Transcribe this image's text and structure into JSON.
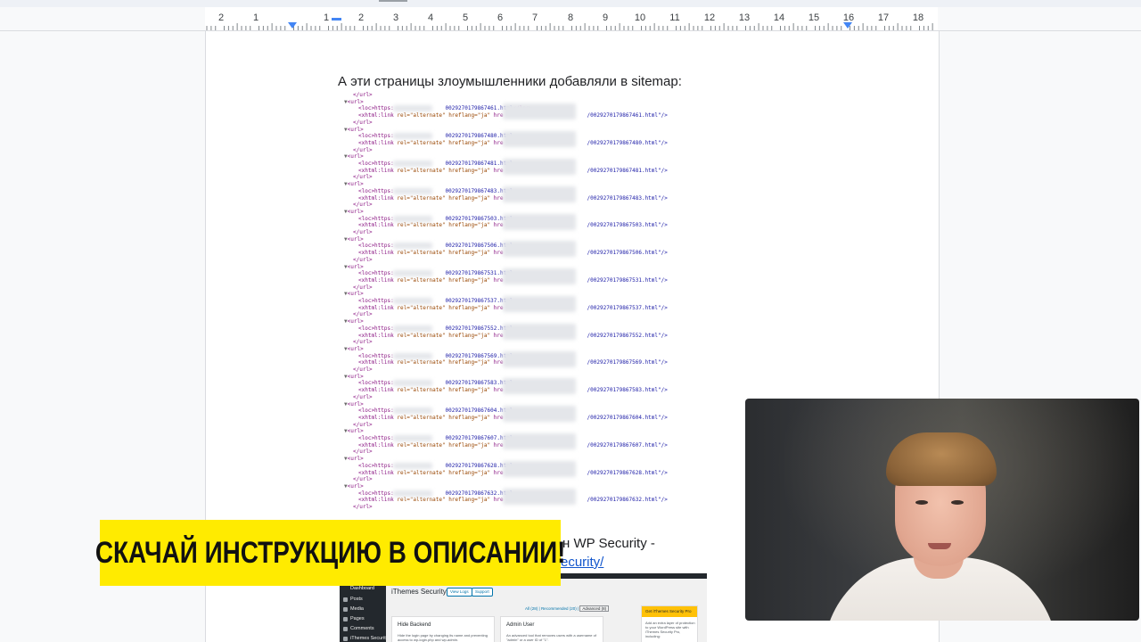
{
  "ruler": {
    "numbers": [
      "2",
      "1",
      "1",
      "2",
      "3",
      "4",
      "5",
      "6",
      "7",
      "8",
      "9",
      "10",
      "11",
      "12",
      "13",
      "14",
      "15",
      "16",
      "17",
      "18"
    ]
  },
  "document": {
    "heading": "А эти страницы злоумышленники добавляли в sitemap:",
    "sitemap_ids": [
      "0029270179867461",
      "0029270179867480",
      "0029270179867481",
      "0029270179867483",
      "0029270179867503",
      "0029270179867506",
      "0029270179867531",
      "0029270179867537",
      "0029270179867552",
      "0029270179867569",
      "0029270179867583",
      "0029270179867604",
      "0029270179867607",
      "0029270179867628",
      "0029270179867632"
    ],
    "code": {
      "close_url": "</url>",
      "open_url": "<url>",
      "loc_open": "<loc>https:",
      "html_suffix": ".html",
      "loc_close": "</loc>",
      "link_tag": "<xhtml:link",
      "rel": "rel=\"alternate\"",
      "hreflang": "hreflang=\"ja\"",
      "href_prefix": "hre",
      "href_end": ".html\"/>"
    },
    "security_text": "н WP Security -",
    "security_link": "ecurity/"
  },
  "wp_screenshot": {
    "sidebar": [
      "Dashboard",
      "Posts",
      "Media",
      "Pages",
      "Comments",
      "iThemes Security"
    ],
    "title": "iThemes Security",
    "view_logs": "View Logs",
    "support": "Support",
    "filter_all": "All (28)",
    "filter_recommended": "Recommended (20)",
    "filter_advanced": "Advanced (8)",
    "cards": [
      {
        "title": "Hide Backend",
        "desc": "Hide the login page by changing its name and preventing access to wp-login.php and wp-admin."
      },
      {
        "title": "Admin User",
        "desc": "An advanced tool that removes users with a username of \"admin\" or a user ID of \"1\"."
      }
    ],
    "pro_title": "Get iThemes Security Pro",
    "pro_desc": "Add an extra layer of protection to your WordPress site with iThemes Security Pro, including:"
  },
  "banner": {
    "text": "СКАЧАЙ ИНСТРУКЦИЮ В ОПИСАНИИ!",
    "color": "#ffeb00"
  },
  "colors": {
    "accent": "#4285f4",
    "link": "#1155cc"
  }
}
